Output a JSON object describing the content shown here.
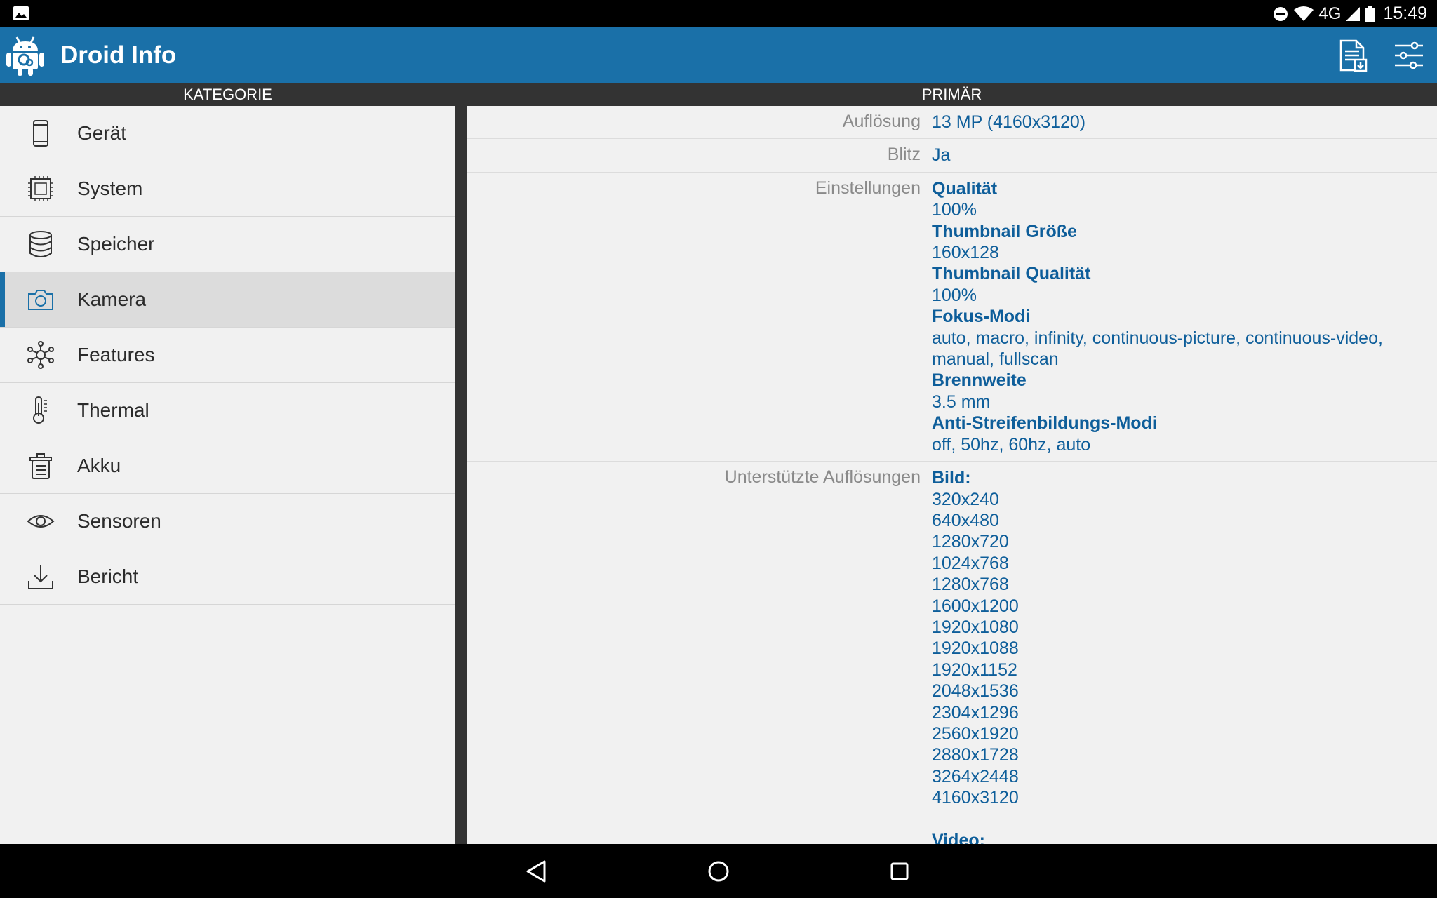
{
  "status_bar": {
    "time": "15:49",
    "network": "4G",
    "icons": [
      "image-notification-icon",
      "do-not-disturb-icon",
      "wifi-icon",
      "cell-signal-icon",
      "battery-icon"
    ]
  },
  "app_bar": {
    "title": "Droid Info",
    "actions": [
      "report-document-icon",
      "settings-sliders-icon"
    ]
  },
  "headers": {
    "left": "KATEGORIE",
    "right": "PRIMÄR"
  },
  "sidebar": {
    "items": [
      {
        "label": "Gerät",
        "icon": "phone-icon"
      },
      {
        "label": "System",
        "icon": "cpu-icon"
      },
      {
        "label": "Speicher",
        "icon": "database-icon"
      },
      {
        "label": "Kamera",
        "icon": "camera-icon",
        "active": true
      },
      {
        "label": "Features",
        "icon": "network-icon"
      },
      {
        "label": "Thermal",
        "icon": "thermometer-icon"
      },
      {
        "label": "Akku",
        "icon": "battery-icon"
      },
      {
        "label": "Sensoren",
        "icon": "eye-icon"
      },
      {
        "label": "Bericht",
        "icon": "download-icon"
      }
    ]
  },
  "main": {
    "rows": [
      {
        "key": "Auflösung",
        "lines": [
          {
            "text": "13 MP (4160x3120)"
          }
        ]
      },
      {
        "key": "Blitz",
        "lines": [
          {
            "text": "Ja"
          }
        ]
      },
      {
        "key": "Einstellungen",
        "lines": [
          {
            "text": "Qualität",
            "bold": true
          },
          {
            "text": "100%"
          },
          {
            "text": "Thumbnail Größe",
            "bold": true
          },
          {
            "text": "160x128"
          },
          {
            "text": "Thumbnail Qualität",
            "bold": true
          },
          {
            "text": "100%"
          },
          {
            "text": "Fokus-Modi",
            "bold": true
          },
          {
            "text": "auto, macro, infinity, continuous-picture, continuous-video,"
          },
          {
            "text": "manual, fullscan"
          },
          {
            "text": "Brennweite",
            "bold": true
          },
          {
            "text": "3.5 mm"
          },
          {
            "text": "Anti-Streifenbildungs-Modi",
            "bold": true
          },
          {
            "text": "off, 50hz, 60hz, auto"
          }
        ]
      },
      {
        "key": "Unterstützte Auflösungen",
        "lines": [
          {
            "text": "Bild:",
            "bold": true
          },
          {
            "text": "320x240"
          },
          {
            "text": "640x480"
          },
          {
            "text": "1280x720"
          },
          {
            "text": "1024x768"
          },
          {
            "text": "1280x768"
          },
          {
            "text": "1600x1200"
          },
          {
            "text": "1920x1080"
          },
          {
            "text": "1920x1088"
          },
          {
            "text": "1920x1152"
          },
          {
            "text": "2048x1536"
          },
          {
            "text": "2304x1296"
          },
          {
            "text": "2560x1920"
          },
          {
            "text": "2880x1728"
          },
          {
            "text": "3264x2448"
          },
          {
            "text": "4160x3120"
          },
          {
            "text": ""
          },
          {
            "text": "Video:",
            "bold": true
          }
        ]
      }
    ]
  },
  "nav_bar": {
    "buttons": [
      "back-icon",
      "home-icon",
      "recents-icon"
    ]
  },
  "colors": {
    "accent": "#1a70a8",
    "value_text": "#0e5e9a",
    "key_text": "#8a8a8a",
    "header_bg": "#333333"
  }
}
